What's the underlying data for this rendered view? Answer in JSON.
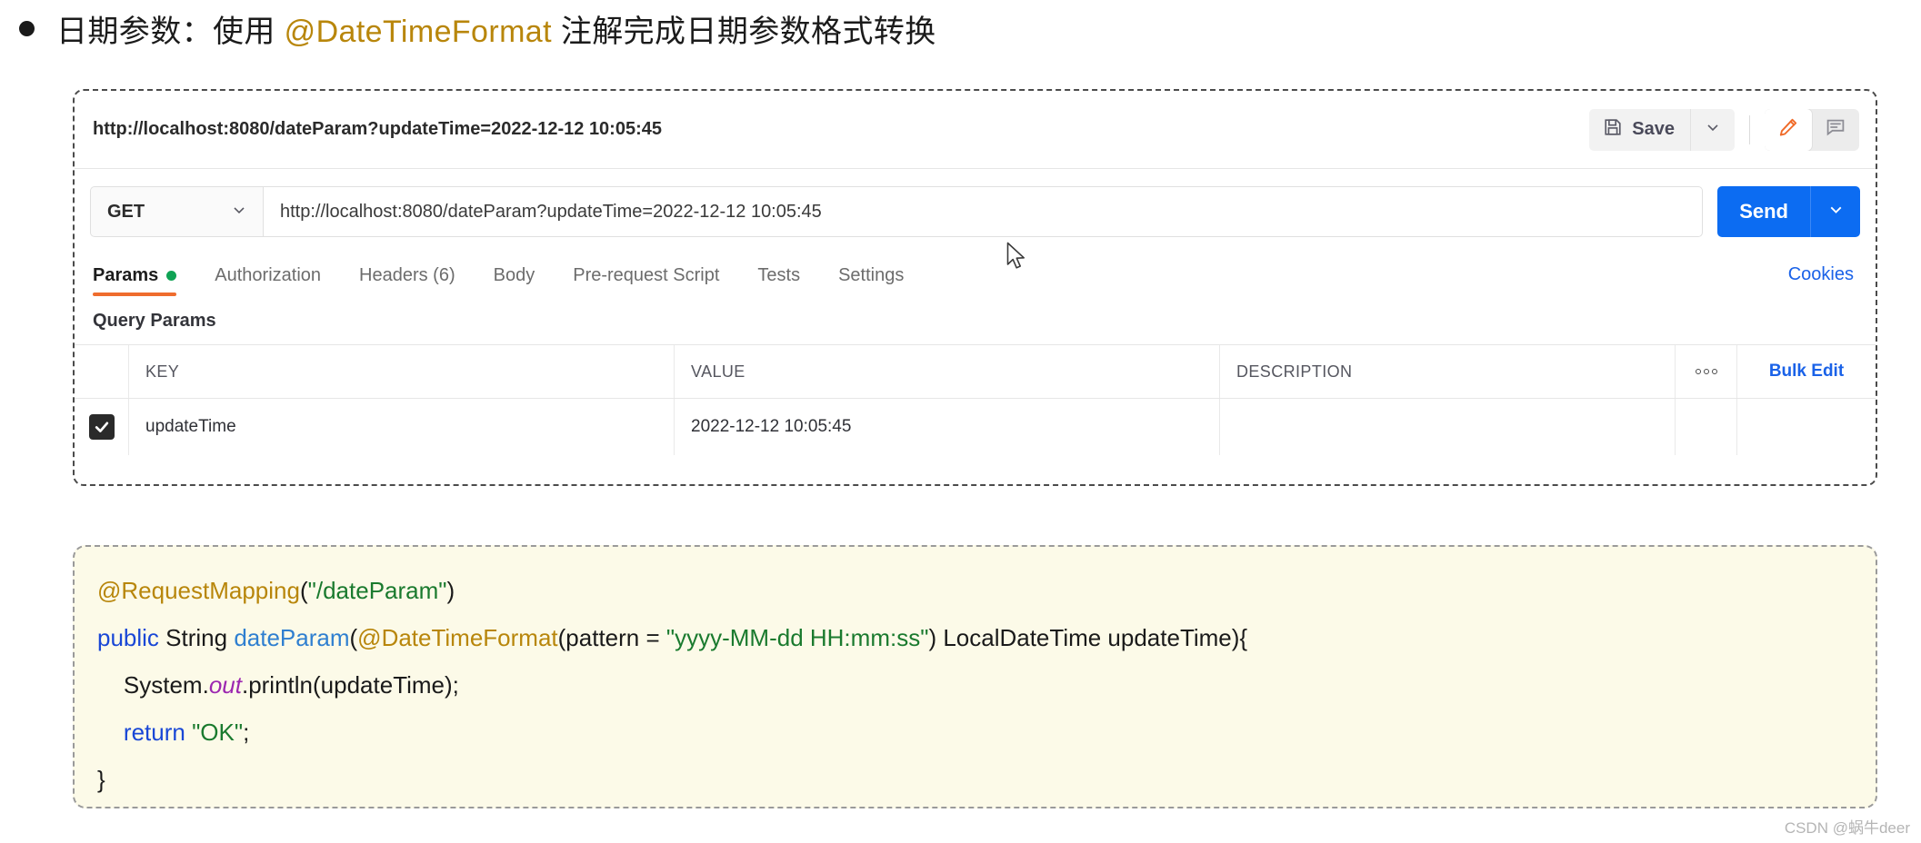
{
  "heading": {
    "bullet": "•",
    "prefix": "日期参数：使用 ",
    "highlight": "@DateTimeFormat",
    "suffix": " 注解完成日期参数格式转换"
  },
  "postman": {
    "tab_title": "http://localhost:8080/dateParam?updateTime=2022-12-12 10:05:45",
    "save_label": "Save",
    "save_icon": "floppy-disk-icon",
    "save_caret_icon": "chevron-down-icon",
    "edit_icon": "pencil-icon",
    "comment_icon": "comment-icon",
    "accent_orange": "#ef6c2e",
    "accent_blue": "#0c6cf2",
    "request": {
      "method": "GET",
      "method_caret_icon": "chevron-down-icon",
      "url": "http://localhost:8080/dateParam?updateTime=2022-12-12 10:05:45",
      "send_label": "Send",
      "send_caret_icon": "chevron-down-icon"
    },
    "tabs": [
      {
        "label": "Params",
        "active": true,
        "dot": true
      },
      {
        "label": "Authorization",
        "active": false,
        "dot": false
      },
      {
        "label": "Headers (6)",
        "active": false,
        "dot": false
      },
      {
        "label": "Body",
        "active": false,
        "dot": false
      },
      {
        "label": "Pre-request Script",
        "active": false,
        "dot": false
      },
      {
        "label": "Tests",
        "active": false,
        "dot": false
      },
      {
        "label": "Settings",
        "active": false,
        "dot": false
      }
    ],
    "cookies_label": "Cookies",
    "query_params": {
      "section_title": "Query Params",
      "columns": [
        "KEY",
        "VALUE",
        "DESCRIPTION"
      ],
      "options_icon": "ellipsis-icon",
      "bulk_edit_label": "Bulk Edit",
      "rows": [
        {
          "checked": true,
          "check_icon": "checkmark-icon",
          "key": "updateTime",
          "value": "2022-12-12 10:05:45",
          "description": ""
        }
      ]
    }
  },
  "code": {
    "lines": [
      {
        "tokens": [
          {
            "t": "@RequestMapping",
            "c": "ann"
          },
          {
            "t": "(",
            "c": "plain"
          },
          {
            "t": "\"/dateParam\"",
            "c": "str"
          },
          {
            "t": ")",
            "c": "plain"
          }
        ]
      },
      {
        "tokens": [
          {
            "t": "public",
            "c": "kw"
          },
          {
            "t": " String ",
            "c": "plain"
          },
          {
            "t": "dateParam",
            "c": "fn"
          },
          {
            "t": "(",
            "c": "plain"
          },
          {
            "t": "@DateTimeFormat",
            "c": "ann"
          },
          {
            "t": "(pattern = ",
            "c": "plain"
          },
          {
            "t": "\"yyyy-MM-dd HH:mm:ss\"",
            "c": "str"
          },
          {
            "t": ") LocalDateTime updateTime){",
            "c": "plain"
          }
        ]
      },
      {
        "tokens": [
          {
            "t": "    System.",
            "c": "plain"
          },
          {
            "t": "out",
            "c": "field"
          },
          {
            "t": ".println(updateTime);",
            "c": "plain"
          }
        ]
      },
      {
        "tokens": [
          {
            "t": "    ",
            "c": "plain"
          },
          {
            "t": "return",
            "c": "kw"
          },
          {
            "t": " ",
            "c": "plain"
          },
          {
            "t": "\"OK\"",
            "c": "str"
          },
          {
            "t": ";",
            "c": "plain"
          }
        ]
      },
      {
        "tokens": [
          {
            "t": "}",
            "c": "plain"
          }
        ]
      }
    ]
  },
  "watermark": "CSDN @蜗牛deer"
}
